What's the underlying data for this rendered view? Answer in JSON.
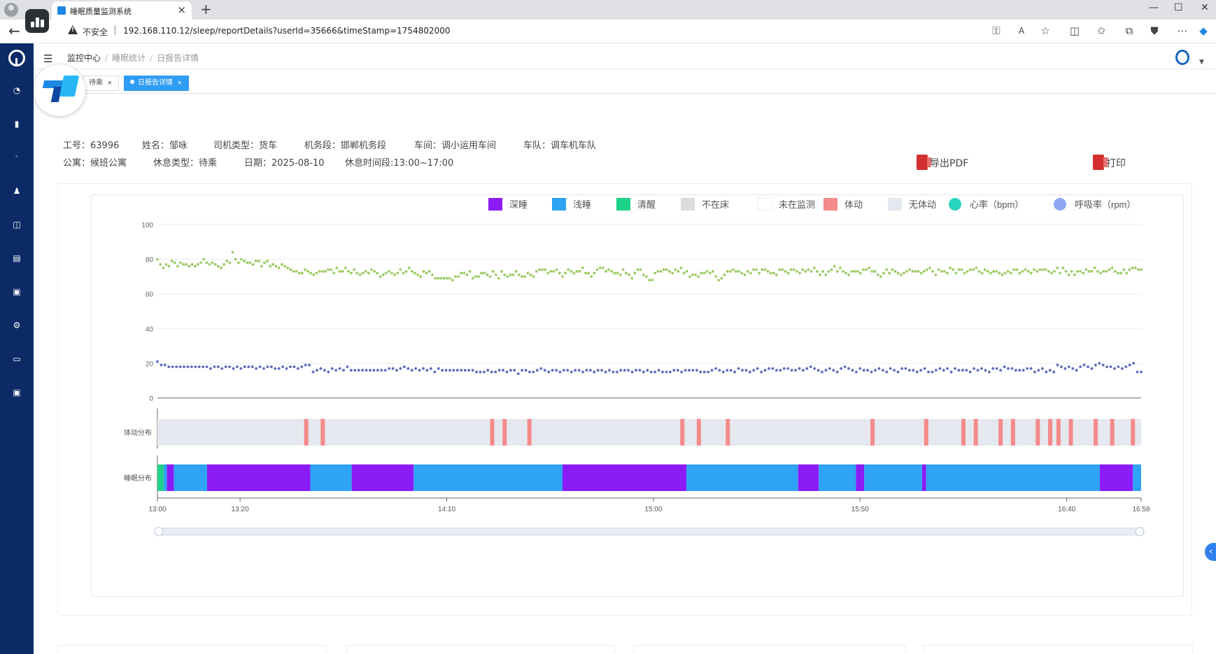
{
  "browser": {
    "tab_title": "睡眠质量监测系统",
    "tab_close": "×",
    "new_tab": "+",
    "insecure_label": "不安全",
    "url": "192.168.110.12/sleep/reportDetails?userId=35666&timeStamp=1754802000",
    "win_min": "—",
    "win_max": "☐",
    "win_close": "✕"
  },
  "header": {
    "breadcrumb": [
      "监控中心",
      "睡眠统计",
      "日报告详情"
    ],
    "tags": [
      {
        "label": "待乘",
        "close": "×",
        "active": false
      },
      {
        "label": "日报告详情",
        "close": "×",
        "active": true
      }
    ]
  },
  "info": {
    "row1": [
      {
        "label": "工号：",
        "value": "63996"
      },
      {
        "label": "姓名：",
        "value": "邹咏"
      },
      {
        "label": "司机类型：",
        "value": "货车"
      },
      {
        "label": "机务段：",
        "value": "邯郸机务段"
      },
      {
        "label": "车间：",
        "value": "调小运用车间"
      },
      {
        "label": "车队：",
        "value": "调车机车队"
      }
    ],
    "row2": [
      {
        "label": "公寓：",
        "value": "候班公寓"
      },
      {
        "label": "休息类型：",
        "value": "待乘"
      },
      {
        "label": "日期：",
        "value": "2025-08-10"
      },
      {
        "label": "休息时间段:",
        "value": "13:00~17:00"
      }
    ],
    "export_pdf": "导出PDF",
    "print": "打印"
  },
  "chart_data": {
    "type": "scatter",
    "legend": [
      {
        "name": "深睡",
        "color": "#8b1cf5",
        "shape": "square"
      },
      {
        "name": "浅睡",
        "color": "#2fa3f5",
        "shape": "square"
      },
      {
        "name": "清醒",
        "color": "#1fd28a",
        "shape": "square"
      },
      {
        "name": "不在床",
        "color": "#dcdcdc",
        "shape": "square"
      },
      {
        "name": "未在监测",
        "color": "#ffffff",
        "shape": "square"
      },
      {
        "name": "体动",
        "color": "#f58a8a",
        "shape": "square"
      },
      {
        "name": "无体动",
        "color": "#e6e8ef",
        "shape": "square"
      },
      {
        "name": "心率（bpm）",
        "color": "#2ad5c0",
        "shape": "circle"
      },
      {
        "name": "呼吸率（rpm）",
        "color": "#8fa6f2",
        "shape": "circle"
      }
    ],
    "y_range": [
      0,
      100
    ],
    "y_ticks": [
      "100",
      "80",
      "60",
      "40",
      "20",
      "0"
    ],
    "x_range_minutes": [
      0,
      238
    ],
    "x_ticks": [
      {
        "label": "13:00",
        "minute": 0
      },
      {
        "label": "13:20",
        "minute": 20
      },
      {
        "label": "14:10",
        "minute": 70
      },
      {
        "label": "15:00",
        "minute": 120
      },
      {
        "label": "15:50",
        "minute": 170
      },
      {
        "label": "16:40",
        "minute": 220
      },
      {
        "label": "16:58",
        "minute": 238
      }
    ],
    "heart_rate_color": "#9ccc65",
    "breath_rate_color": "#5c6bc0",
    "heart_rate": [
      80,
      77,
      75,
      77,
      76,
      79,
      78,
      76,
      78,
      77,
      77,
      76,
      77,
      76,
      77,
      78,
      80,
      78,
      77,
      78,
      77,
      76,
      75,
      77,
      79,
      78,
      84,
      80,
      78,
      80,
      79,
      78,
      78,
      77,
      79,
      79,
      76,
      78,
      79,
      76,
      77,
      76,
      75,
      77,
      76,
      75,
      74,
      73,
      73,
      72,
      72,
      74,
      73,
      72,
      71,
      72,
      73,
      73,
      73,
      74,
      74,
      72,
      75,
      73,
      73,
      75,
      73,
      72,
      74,
      72,
      71,
      72,
      73,
      72,
      74,
      73,
      72,
      70,
      71,
      72,
      73,
      72,
      71,
      72,
      74,
      72,
      73,
      75,
      73,
      72,
      71,
      70,
      73,
      72,
      73,
      71,
      69,
      69,
      69,
      69,
      69,
      69,
      68,
      70,
      70,
      72,
      72,
      71,
      73,
      69,
      70,
      70,
      72,
      72,
      71,
      70,
      73,
      71,
      69,
      73,
      71,
      70,
      71,
      71,
      73,
      71,
      70,
      70,
      72,
      71,
      70,
      73,
      74,
      74,
      74,
      72,
      73,
      73,
      74,
      72,
      70,
      72,
      74,
      73,
      72,
      73,
      73,
      75,
      72,
      72,
      70,
      72,
      74,
      75,
      75,
      73,
      74,
      73,
      72,
      72,
      71,
      74,
      72,
      71,
      69,
      72,
      74,
      74,
      71,
      70,
      68,
      68,
      72,
      73,
      73,
      74,
      74,
      73,
      72,
      74,
      73,
      75,
      72,
      73,
      70,
      71,
      71,
      70,
      72,
      72,
      73,
      72,
      73,
      70,
      68,
      69,
      71,
      73,
      73,
      74,
      73,
      73,
      72,
      71,
      73,
      72,
      74,
      74,
      72,
      74,
      74,
      73,
      72,
      72,
      71,
      74,
      74,
      73,
      72,
      74,
      74,
      73,
      72,
      74,
      73,
      74,
      73,
      75,
      73,
      71,
      73,
      71,
      73,
      74,
      76,
      73,
      75,
      73,
      72,
      71,
      73,
      73,
      73,
      72,
      74,
      74,
      75,
      73,
      73,
      71,
      70,
      72,
      74,
      72,
      74,
      73,
      72,
      71,
      72,
      73,
      74,
      73,
      73,
      73,
      72,
      73,
      74,
      75,
      73,
      71,
      74,
      73,
      73,
      72,
      75,
      74,
      72,
      74,
      74,
      72,
      73,
      74,
      74,
      75,
      73,
      72,
      74,
      73,
      72,
      73,
      73,
      72,
      71,
      72,
      73,
      72,
      74,
      74,
      72,
      73,
      74,
      73,
      72,
      74,
      73,
      74,
      74,
      74,
      73,
      72,
      73,
      75,
      72,
      75,
      73,
      71,
      73,
      71,
      73,
      73,
      72,
      74,
      73,
      73,
      75,
      73,
      72,
      73,
      73,
      74,
      75,
      73,
      72,
      72,
      74,
      72,
      74,
      75,
      75,
      74,
      74
    ],
    "breath_rate": [
      21,
      19,
      19,
      18,
      18,
      18,
      18,
      18,
      18,
      18,
      18,
      18,
      18,
      18,
      17,
      18,
      18,
      17,
      18,
      18,
      17,
      18,
      17,
      18,
      18,
      18,
      17,
      18,
      17,
      18,
      18,
      17,
      17,
      18,
      17,
      18,
      18,
      17,
      18,
      19,
      19,
      15,
      16,
      17,
      16,
      15,
      17,
      16,
      17,
      16,
      18,
      16,
      16,
      16,
      16,
      16,
      16,
      16,
      16,
      16,
      16,
      17,
      17,
      16,
      17,
      18,
      17,
      16,
      17,
      16,
      17,
      16,
      17,
      15,
      17,
      16,
      16,
      16,
      16,
      16,
      16,
      16,
      16,
      16,
      15,
      15,
      15,
      16,
      15,
      15,
      16,
      16,
      15,
      16,
      16,
      14,
      16,
      16,
      15,
      15,
      16,
      17,
      16,
      15,
      16,
      16,
      15,
      16,
      16,
      15,
      16,
      16,
      15,
      16,
      16,
      15,
      16,
      16,
      15,
      16,
      15,
      15,
      16,
      16,
      16,
      15,
      16,
      16,
      15,
      16,
      15,
      15,
      16,
      15,
      15,
      15,
      16,
      16,
      15,
      16,
      16,
      16,
      16,
      15,
      15,
      15,
      16,
      17,
      16,
      15,
      16,
      16,
      15,
      17,
      16,
      16,
      15,
      16,
      17,
      15,
      16,
      17,
      17,
      16,
      16,
      17,
      17,
      16,
      16,
      17,
      16,
      17,
      18,
      17,
      16,
      15,
      16,
      17,
      16,
      15,
      17,
      18,
      17,
      16,
      15,
      17,
      16,
      16,
      15,
      16,
      17,
      16,
      15,
      17,
      16,
      15,
      17,
      17,
      16,
      16,
      15,
      16,
      17,
      15,
      15,
      16,
      17,
      16,
      17,
      15,
      17,
      16,
      16,
      16,
      15,
      17,
      16,
      17,
      16,
      15,
      17,
      17,
      16,
      18,
      17,
      17,
      16,
      16,
      16,
      17,
      17,
      15,
      16,
      17,
      15,
      16,
      15,
      19,
      18,
      17,
      18,
      17,
      16,
      18,
      19,
      18,
      17,
      19,
      20,
      19,
      18,
      18,
      17,
      18,
      17,
      18,
      19,
      20,
      15,
      15
    ],
    "body_movement_label": "体动分布",
    "body_movement_minutes": [
      36,
      40,
      81,
      84,
      90,
      127,
      131,
      138,
      173,
      186,
      195,
      198,
      204,
      207,
      213,
      216,
      218,
      221,
      227,
      231,
      236
    ],
    "sleep_stage_label": "睡眠分布",
    "sleep_stages": [
      {
        "stage": "清醒",
        "from": 0,
        "to": 1.5
      },
      {
        "stage": "浅睡",
        "from": 1.5,
        "to": 2.3
      },
      {
        "stage": "深睡",
        "from": 2.3,
        "to": 4
      },
      {
        "stage": "浅睡",
        "from": 4,
        "to": 12
      },
      {
        "stage": "深睡",
        "from": 12,
        "to": 37
      },
      {
        "stage": "浅睡",
        "from": 37,
        "to": 47
      },
      {
        "stage": "深睡",
        "from": 47,
        "to": 62
      },
      {
        "stage": "浅睡",
        "from": 62,
        "to": 98
      },
      {
        "stage": "深睡",
        "from": 98,
        "to": 128
      },
      {
        "stage": "浅睡",
        "from": 128,
        "to": 155
      },
      {
        "stage": "深睡",
        "from": 155,
        "to": 160
      },
      {
        "stage": "浅睡",
        "from": 160,
        "to": 169
      },
      {
        "stage": "深睡",
        "from": 169,
        "to": 171
      },
      {
        "stage": "浅睡",
        "from": 171,
        "to": 185
      },
      {
        "stage": "深睡",
        "from": 185,
        "to": 186
      },
      {
        "stage": "浅睡",
        "from": 186,
        "to": 228
      },
      {
        "stage": "深睡",
        "from": 228,
        "to": 236
      },
      {
        "stage": "浅睡",
        "from": 236,
        "to": 238
      }
    ]
  }
}
